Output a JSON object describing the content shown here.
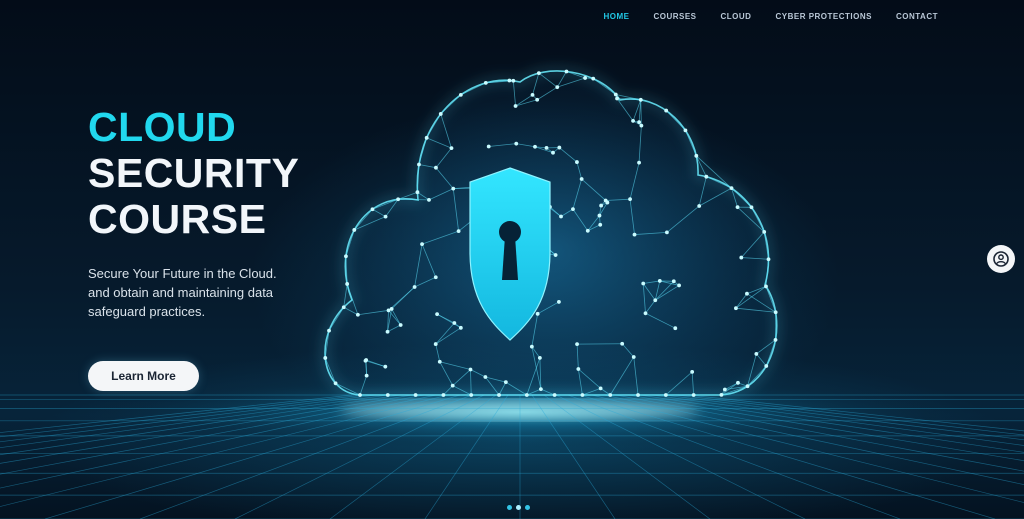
{
  "nav": {
    "items": [
      {
        "label": "HOME",
        "active": true
      },
      {
        "label": "COURSES",
        "active": false
      },
      {
        "label": "CLOUD",
        "active": false
      },
      {
        "label": "CYBER PROTECTIONS",
        "active": false
      },
      {
        "label": "CONTACT",
        "active": false
      }
    ]
  },
  "hero": {
    "title_accent": "CLOUD",
    "title_line2": "SECURITY",
    "title_line3": "COURSE",
    "subtitle_lines": [
      "Secure Your Future in the Cloud.",
      "and obtain and maintaining data",
      "safeguard practices."
    ],
    "cta_label": "Learn More"
  },
  "side_widget": {
    "icon": "user-icon"
  },
  "pager": {
    "count": 3,
    "active_index": 1
  },
  "colors": {
    "accent": "#21d8ee",
    "background": "#04101f",
    "shield": "#1fd8f0",
    "mesh": "#5fe6ff"
  },
  "icons": {
    "shield": "shield-keyhole-icon",
    "cloud": "cloud-network-icon"
  }
}
